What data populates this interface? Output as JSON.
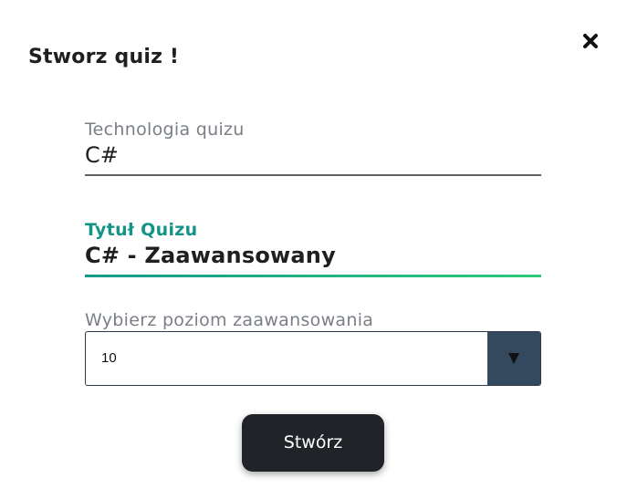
{
  "modal": {
    "title": "Stworz quiz !",
    "close_icon": "close-icon"
  },
  "form": {
    "technology": {
      "label": "Technologia quizu",
      "value": "C#"
    },
    "title": {
      "label": "Tytuł Quizu",
      "value": "C# - Zaawansowany"
    },
    "level": {
      "label": "Wybierz poziom zaawansowania",
      "selected": "10",
      "arrow_icon": "triangle-down-icon"
    },
    "submit_label": "Stwórz"
  },
  "colors": {
    "accent": "#149486",
    "accent_end": "#2ec97a",
    "select_arrow_bg": "#34495e",
    "button_bg": "#202428"
  }
}
